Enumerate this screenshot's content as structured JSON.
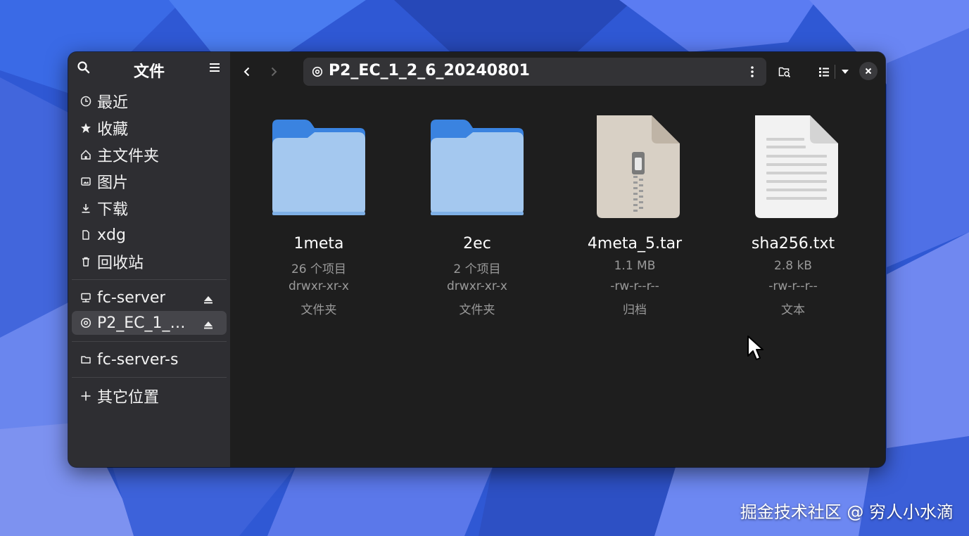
{
  "sidebar": {
    "title": "文件",
    "places": [
      {
        "label": "最近",
        "icon": "clock-icon"
      },
      {
        "label": "收藏",
        "icon": "star-icon"
      },
      {
        "label": "主文件夹",
        "icon": "home-icon"
      },
      {
        "label": "图片",
        "icon": "image-icon"
      },
      {
        "label": "下载",
        "icon": "download-icon"
      },
      {
        "label": "xdg",
        "icon": "document-icon"
      },
      {
        "label": "回收站",
        "icon": "trash-icon"
      }
    ],
    "mounts": [
      {
        "label": "fc-server",
        "icon": "network-server-icon",
        "ejectable": true
      },
      {
        "label": "P2_EC_1_…",
        "icon": "disc-icon",
        "ejectable": true,
        "active": true
      }
    ],
    "bookmarks": [
      {
        "label": "fc-server-s",
        "icon": "folder-icon"
      }
    ],
    "other_locations": {
      "label": "其它位置",
      "icon": "plus-icon"
    }
  },
  "toolbar": {
    "path": "P2_EC_1_2_6_20240801",
    "path_icon": "disc-icon"
  },
  "files": [
    {
      "name": "1meta",
      "count": "26 个项目",
      "perms": "drwxr-xr-x",
      "kind": "文件夹",
      "type": "folder"
    },
    {
      "name": "2ec",
      "count": "2 个项目",
      "perms": "drwxr-xr-x",
      "kind": "文件夹",
      "type": "folder"
    },
    {
      "name": "4meta_5.tar",
      "count": "1.1 MB",
      "perms": "-rw-r--r--",
      "kind": "归档",
      "type": "archive"
    },
    {
      "name": "sha256.txt",
      "count": "2.8 kB",
      "perms": "-rw-r--r--",
      "kind": "文本",
      "type": "text"
    }
  ],
  "watermark": "掘金技术社区 @ 穷人小水滴",
  "colors": {
    "folder_back": "#3a83e0",
    "folder_front": "#a4c8ef",
    "archive": "#d8d0c5",
    "text_doc": "#f2f2f2",
    "desktop": "#2f58d4"
  }
}
